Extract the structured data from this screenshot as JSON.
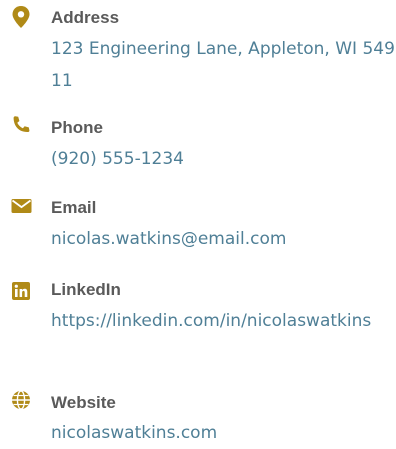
{
  "colors": {
    "accent": "#b08a17",
    "label": "#5a5a5a",
    "value": "#4f7f96"
  },
  "contacts": [
    {
      "icon": "map-pin-icon",
      "label": "Address",
      "value": "123 Engineering Lane, Appleton, WI 54911"
    },
    {
      "icon": "phone-icon",
      "label": "Phone",
      "value": "(920) 555-1234"
    },
    {
      "icon": "envelope-icon",
      "label": "Email",
      "value": "nicolas.watkins@email.com"
    },
    {
      "icon": "linkedin-icon",
      "label": "LinkedIn",
      "value": "https://linkedin.com/in/nicolaswatkins"
    },
    {
      "icon": "globe-icon",
      "label": "Website",
      "value": "nicolaswatkins.com"
    }
  ]
}
